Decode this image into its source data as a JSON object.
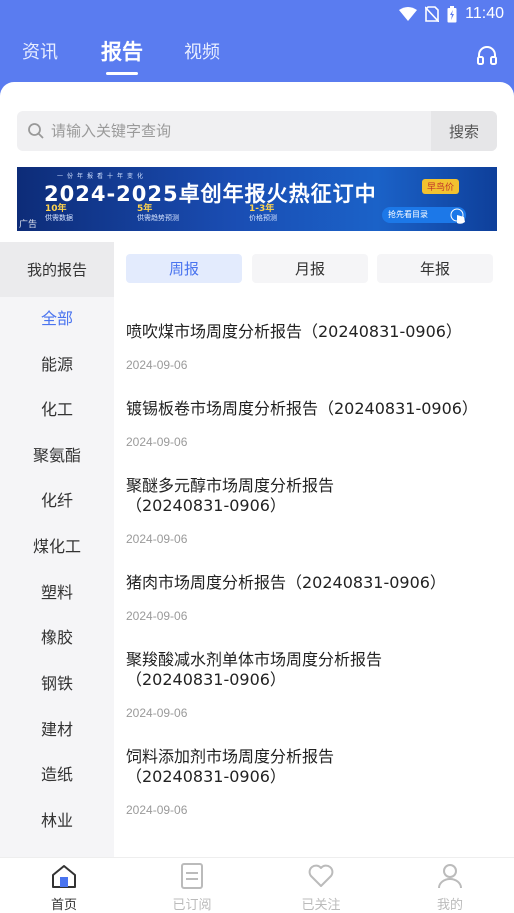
{
  "status_bar": {
    "time": "11:40"
  },
  "header": {
    "tabs": [
      {
        "label": "资讯"
      },
      {
        "label": "报告"
      },
      {
        "label": "视频"
      }
    ],
    "active_tab": "报告",
    "accent_color": "#5a7cf0"
  },
  "search": {
    "placeholder": "请输入关键字查询",
    "button_label": "搜索"
  },
  "banner": {
    "small_text": "一份年报看十年变化",
    "title": "2024-2025卓创年报火热征订中",
    "tag": "早鸟价",
    "stats": [
      {
        "value": "10年",
        "caption": "供需数据"
      },
      {
        "value": "5年",
        "caption": "供需趋势预测"
      },
      {
        "value": "1-3年",
        "caption": "价格预测"
      }
    ],
    "cta": "抢先看目录",
    "ad_label": "广告"
  },
  "sidebar": {
    "header": "我的报告",
    "categories": [
      "全部",
      "能源",
      "化工",
      "聚氨酯",
      "化纤",
      "煤化工",
      "塑料",
      "橡胶",
      "钢铁",
      "建材",
      "造纸",
      "林业"
    ],
    "active": "全部"
  },
  "period_tabs": {
    "items": [
      "周报",
      "月报",
      "年报"
    ],
    "active": "周报"
  },
  "reports": [
    {
      "title": "喷吹煤市场周度分析报告（20240831-0906）",
      "date": "2024-09-06"
    },
    {
      "title": "镀锡板卷市场周度分析报告（20240831-0906）",
      "date": "2024-09-06"
    },
    {
      "title_line1": "聚醚多元醇市场周度分析报告",
      "title_line2": "（20240831-0906）",
      "date": "2024-09-06"
    },
    {
      "title": "猪肉市场周度分析报告（20240831-0906）",
      "date": "2024-09-06"
    },
    {
      "title_line1": "聚羧酸减水剂单体市场周度分析报告",
      "title_line2": "（20240831-0906）",
      "date": "2024-09-06"
    },
    {
      "title_line1": "饲料添加剂市场周度分析报告",
      "title_line2": "（20240831-0906）",
      "date": "2024-09-06"
    }
  ],
  "bottom_nav": {
    "items": [
      {
        "label": "首页",
        "icon": "home-icon"
      },
      {
        "label": "已订阅",
        "icon": "subscribed-icon"
      },
      {
        "label": "已关注",
        "icon": "heart-icon"
      },
      {
        "label": "我的",
        "icon": "user-icon"
      }
    ],
    "active": "首页"
  }
}
